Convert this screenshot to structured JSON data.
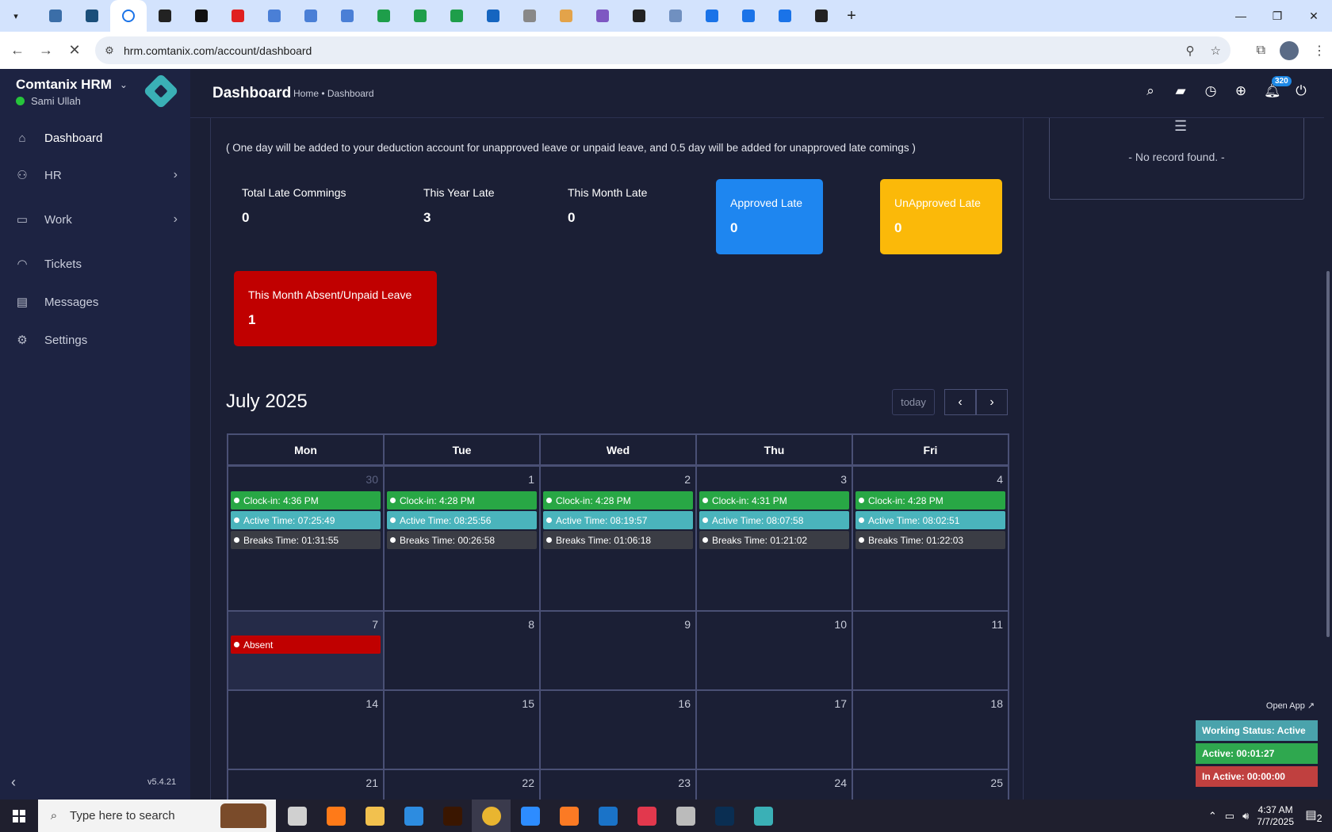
{
  "browser": {
    "url": "hrm.comtanix.com/account/dashboard",
    "tab_count_visible": 22
  },
  "app": {
    "brand": "Comtanix HRM",
    "user": "Sami Ullah",
    "version": "v5.4.21",
    "nav": [
      {
        "label": "Dashboard",
        "icon": "home-icon"
      },
      {
        "label": "HR",
        "icon": "users-icon"
      },
      {
        "label": "Work",
        "icon": "briefcase-icon"
      },
      {
        "label": "Tickets",
        "icon": "headset-icon"
      },
      {
        "label": "Messages",
        "icon": "message-icon"
      },
      {
        "label": "Settings",
        "icon": "gear-icon"
      }
    ]
  },
  "header": {
    "title": "Dashboard",
    "breadcrumb": "Home • Dashboard",
    "notification_count": "320"
  },
  "attendance": {
    "note": "( One day will be added to your deduction account for unapproved leave or unpaid leave, and 0.5 day will be added for unapproved late comings )",
    "stats": [
      {
        "label": "Total Late Commings",
        "value": "0"
      },
      {
        "label": "This Year Late",
        "value": "3"
      },
      {
        "label": "This Month Late",
        "value": "0"
      }
    ],
    "cards": [
      {
        "label": "Approved Late",
        "value": "0",
        "color": "#1e86f0"
      },
      {
        "label": "UnApproved Late",
        "value": "0",
        "color": "#fbb909"
      },
      {
        "label": "This Month Absent/Unpaid Leave",
        "value": "1",
        "color": "#c00000"
      }
    ]
  },
  "calendar": {
    "title": "July 2025",
    "today_label": "today",
    "weekdays": [
      "Mon",
      "Tue",
      "Wed",
      "Thu",
      "Fri"
    ],
    "weeks": [
      [
        {
          "day": "30",
          "clockin": "Clock-in: 4:36 PM",
          "active": "Active Time: 07:25:49",
          "breaks": "Breaks Time: 01:31:55"
        },
        {
          "day": "1",
          "clockin": "Clock-in: 4:28 PM",
          "active": "Active Time: 08:25:56",
          "breaks": "Breaks Time: 00:26:58"
        },
        {
          "day": "2",
          "clockin": "Clock-in: 4:28 PM",
          "active": "Active Time: 08:19:57",
          "breaks": "Breaks Time: 01:06:18"
        },
        {
          "day": "3",
          "clockin": "Clock-in: 4:31 PM",
          "active": "Active Time: 08:07:58",
          "breaks": "Breaks Time: 01:21:02"
        },
        {
          "day": "4",
          "clockin": "Clock-in: 4:28 PM",
          "active": "Active Time: 08:02:51",
          "breaks": "Breaks Time: 01:22:03"
        }
      ],
      [
        {
          "day": "7",
          "event": "Absent"
        },
        {
          "day": "8"
        },
        {
          "day": "9"
        },
        {
          "day": "10"
        },
        {
          "day": "11"
        }
      ],
      [
        {
          "day": "14"
        },
        {
          "day": "15"
        },
        {
          "day": "16"
        },
        {
          "day": "17"
        },
        {
          "day": "18"
        }
      ],
      [
        {
          "day": "21"
        },
        {
          "day": "22"
        },
        {
          "day": "23"
        },
        {
          "day": "24"
        },
        {
          "day": "25"
        }
      ]
    ]
  },
  "right_panel": {
    "empty_text": "- No record found. -"
  },
  "status_widget": {
    "open_app": "Open App ↗",
    "working_status": "Working Status: Active",
    "active": "Active: 00:01:27",
    "inactive": "In Active: 00:00:00"
  },
  "taskbar": {
    "search_placeholder": "Type here to search",
    "time": "4:37 AM",
    "date": "7/7/2025",
    "notification_count": "2"
  }
}
